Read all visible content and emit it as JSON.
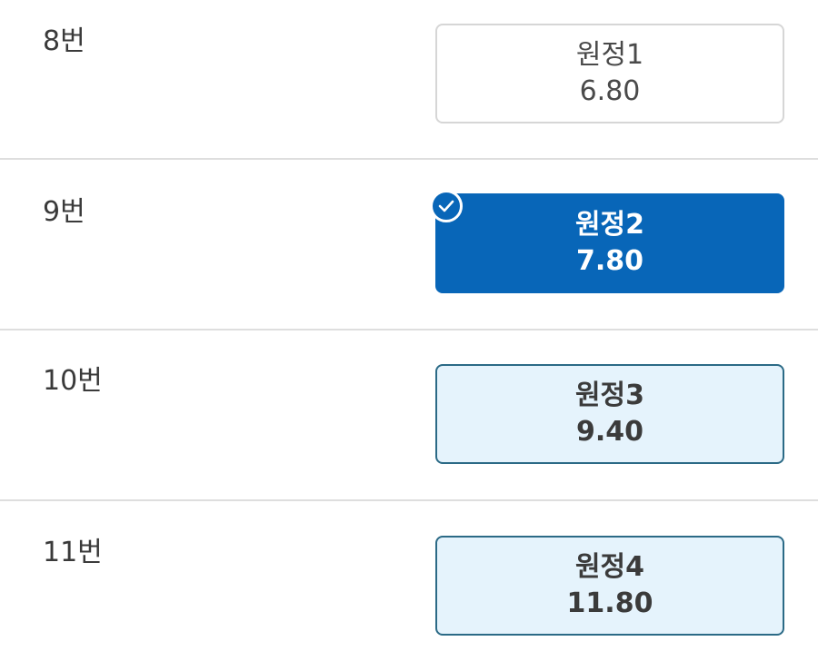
{
  "rows": [
    {
      "label": "8번",
      "option": {
        "name": "원정1",
        "odds": "6.80",
        "state": "default"
      }
    },
    {
      "label": "9번",
      "option": {
        "name": "원정2",
        "odds": "7.80",
        "state": "selected"
      }
    },
    {
      "label": "10번",
      "option": {
        "name": "원정3",
        "odds": "9.40",
        "state": "highlight"
      }
    },
    {
      "label": "11번",
      "option": {
        "name": "원정4",
        "odds": "11.80",
        "state": "highlight"
      }
    }
  ],
  "icons": {
    "selected_badge": "check-circle-icon"
  },
  "colors": {
    "selected_bg": "#0866b8",
    "highlight_bg": "#e5f3fc",
    "highlight_border": "#2b6a86",
    "default_border": "#d6d6d6",
    "divider": "#dedede"
  }
}
